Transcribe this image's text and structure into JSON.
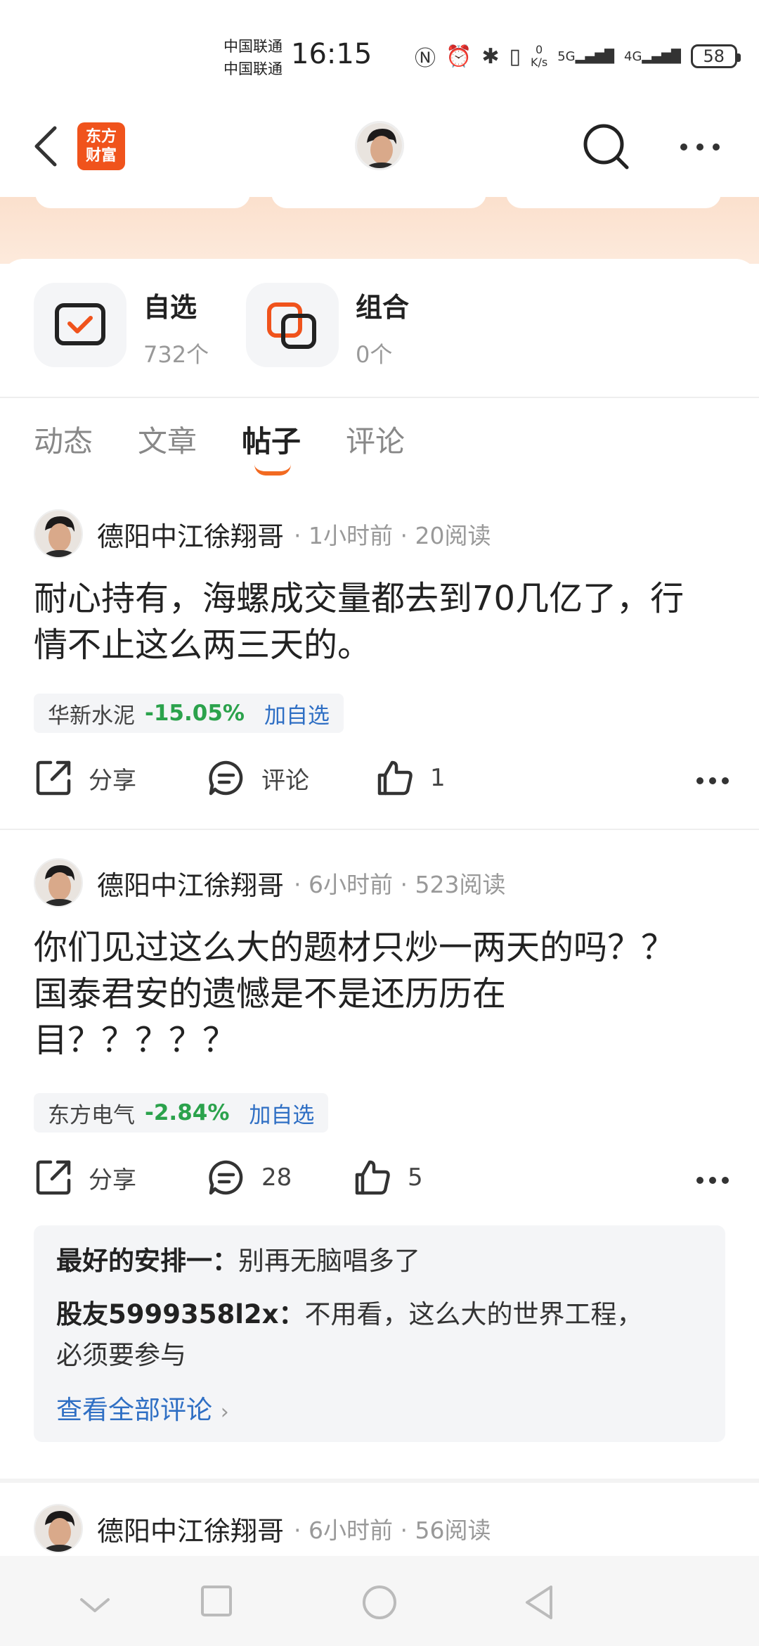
{
  "status": {
    "carrier1": "中国联通",
    "carrier2": "中国联通",
    "time": "16:15",
    "net_speed_top": "0",
    "net_speed_unit": "K/s",
    "sig1": "5G",
    "sig2": "4G",
    "battery": "58"
  },
  "header": {
    "logo_line1": "东方",
    "logo_line2": "财富"
  },
  "favorites": [
    {
      "title": "自选",
      "count": "732个"
    },
    {
      "title": "组合",
      "count": "0个"
    }
  ],
  "tabs": [
    {
      "label": "动态",
      "active": false
    },
    {
      "label": "文章",
      "active": false
    },
    {
      "label": "帖子",
      "active": true
    },
    {
      "label": "评论",
      "active": false
    }
  ],
  "posts": [
    {
      "author": "德阳中江徐翔哥",
      "time": "1小时前",
      "reads": "20阅读",
      "line1": "耐心持有，海螺成交量都去到70几亿了，行",
      "line2": "情不止这么两三天的。",
      "stock_name": "华新水泥",
      "stock_change": "-15.05%",
      "add_label": "加自选",
      "share_label": "分享",
      "comment_label": "评论",
      "like_count": "1"
    },
    {
      "author": "德阳中江徐翔哥",
      "time": "6小时前",
      "reads": "523阅读",
      "line1": "你们见过这么大的题材只炒一两天的吗？？",
      "line2": "国泰君安的遗憾是不是还历历在",
      "line3": "目？？？？？",
      "stock_name": "东方电气",
      "stock_change": "-2.84%",
      "add_label": "加自选",
      "share_label": "分享",
      "comment_count": "28",
      "like_count": "5",
      "comments": [
        {
          "user": "最好的安排一：",
          "text": "别再无脑唱多了"
        },
        {
          "user": "股友5999358l2x：",
          "text": "不用看，这么大的世界工程，",
          "text2": "必须要参与"
        }
      ],
      "view_all": "查看全部评论"
    },
    {
      "author": "德阳中江徐翔哥",
      "time": "6小时前",
      "reads": "56阅读"
    }
  ],
  "colors": {
    "brand": "#f0531c",
    "tab_indicator": "#f26a21",
    "down": "#2ba24c",
    "link": "#2f6fc4"
  }
}
